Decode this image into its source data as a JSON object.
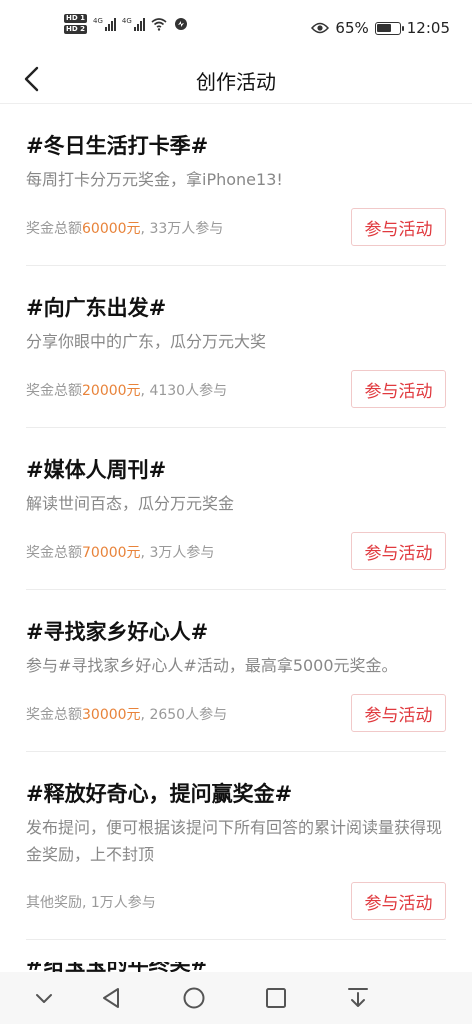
{
  "status_bar": {
    "sim1_badge": "HD 1",
    "sim2_badge": "HD 2",
    "signal1_label": "4G",
    "signal2_label": "4G",
    "battery_percent": "65%",
    "battery_level": 0.65,
    "time": "12:05"
  },
  "header": {
    "title": "创作活动"
  },
  "activities": [
    {
      "title": "#冬日生活打卡季#",
      "desc": "每周打卡分万元奖金，拿iPhone13!",
      "meta_prefix": "奖金总额",
      "amount": "60000元",
      "meta_suffix": ", 33万人参与",
      "button": "参与活动"
    },
    {
      "title": "#向广东出发#",
      "desc": "分享你眼中的广东，瓜分万元大奖",
      "meta_prefix": "奖金总额",
      "amount": "20000元",
      "meta_suffix": ", 4130人参与",
      "button": "参与活动"
    },
    {
      "title": "#媒体人周刊#",
      "desc": "解读世间百态，瓜分万元奖金",
      "meta_prefix": "奖金总额",
      "amount": "70000元",
      "meta_suffix": ", 3万人参与",
      "button": "参与活动"
    },
    {
      "title": "#寻找家乡好心人#",
      "desc": "参与#寻找家乡好心人#活动，最高拿5000元奖金。",
      "meta_prefix": "奖金总额",
      "amount": "30000元",
      "meta_suffix": ", 2650人参与",
      "button": "参与活动"
    },
    {
      "title": "#释放好奇心，提问赢奖金#",
      "desc": "发布提问，便可根据该提问下所有回答的累计阅读量获得现金奖励，上不封顶",
      "meta_prefix": "其他奖励, 1万人参与",
      "amount": "",
      "meta_suffix": "",
      "button": "参与活动"
    }
  ],
  "next_item_peek": "#给宝宝的年终奖#",
  "colors": {
    "accent_red": "#e0393e",
    "amount_orange": "#e8833a"
  },
  "nav_icons": [
    "chevron-down-icon",
    "back-triangle-icon",
    "home-circle-icon",
    "recents-square-icon",
    "download-icon"
  ]
}
